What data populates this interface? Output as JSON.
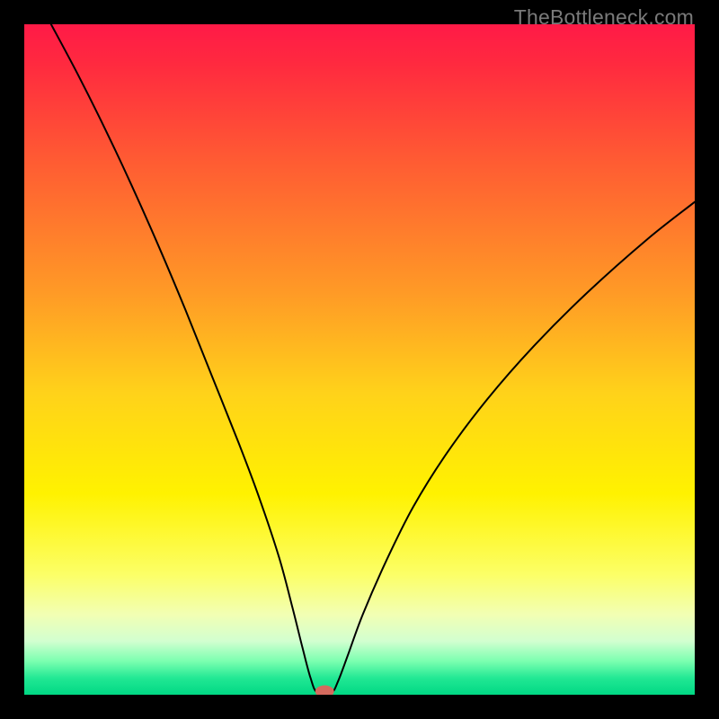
{
  "watermark": "TheBottleneck.com",
  "chart_data": {
    "type": "line",
    "title": "",
    "xlabel": "",
    "ylabel": "",
    "xlim": [
      0,
      100
    ],
    "ylim": [
      0,
      100
    ],
    "background_gradient": {
      "stops": [
        {
          "offset": 0.0,
          "color": "#ff1a47"
        },
        {
          "offset": 0.06,
          "color": "#ff2a3f"
        },
        {
          "offset": 0.2,
          "color": "#ff5a33"
        },
        {
          "offset": 0.4,
          "color": "#ff9a26"
        },
        {
          "offset": 0.55,
          "color": "#ffd21a"
        },
        {
          "offset": 0.7,
          "color": "#fff200"
        },
        {
          "offset": 0.82,
          "color": "#fcff66"
        },
        {
          "offset": 0.88,
          "color": "#f2ffb3"
        },
        {
          "offset": 0.92,
          "color": "#d2ffd0"
        },
        {
          "offset": 0.95,
          "color": "#7bffb0"
        },
        {
          "offset": 0.975,
          "color": "#22e894"
        },
        {
          "offset": 1.0,
          "color": "#00d884"
        }
      ]
    },
    "series": [
      {
        "name": "bottleneck-curve",
        "color": "#000000",
        "width": 2.0,
        "points": [
          {
            "x": 4.0,
            "y": 100.0
          },
          {
            "x": 8.0,
            "y": 92.5
          },
          {
            "x": 12.0,
            "y": 84.5
          },
          {
            "x": 16.0,
            "y": 76.0
          },
          {
            "x": 20.0,
            "y": 67.0
          },
          {
            "x": 24.0,
            "y": 57.5
          },
          {
            "x": 28.0,
            "y": 47.5
          },
          {
            "x": 32.0,
            "y": 37.5
          },
          {
            "x": 35.0,
            "y": 29.5
          },
          {
            "x": 38.0,
            "y": 20.5
          },
          {
            "x": 40.0,
            "y": 13.0
          },
          {
            "x": 41.5,
            "y": 7.0
          },
          {
            "x": 42.7,
            "y": 2.5
          },
          {
            "x": 43.7,
            "y": 0.3
          },
          {
            "x": 45.8,
            "y": 0.3
          },
          {
            "x": 46.8,
            "y": 2.0
          },
          {
            "x": 48.3,
            "y": 6.0
          },
          {
            "x": 50.5,
            "y": 12.0
          },
          {
            "x": 54.0,
            "y": 20.0
          },
          {
            "x": 58.0,
            "y": 28.0
          },
          {
            "x": 63.0,
            "y": 36.0
          },
          {
            "x": 69.0,
            "y": 44.0
          },
          {
            "x": 76.0,
            "y": 52.0
          },
          {
            "x": 84.0,
            "y": 60.0
          },
          {
            "x": 93.0,
            "y": 68.0
          },
          {
            "x": 100.0,
            "y": 73.5
          }
        ]
      }
    ],
    "marker": {
      "name": "optimal-point",
      "x": 44.8,
      "y": 0.5,
      "rx": 1.4,
      "ry": 0.9,
      "fill": "#d46a5e"
    }
  }
}
